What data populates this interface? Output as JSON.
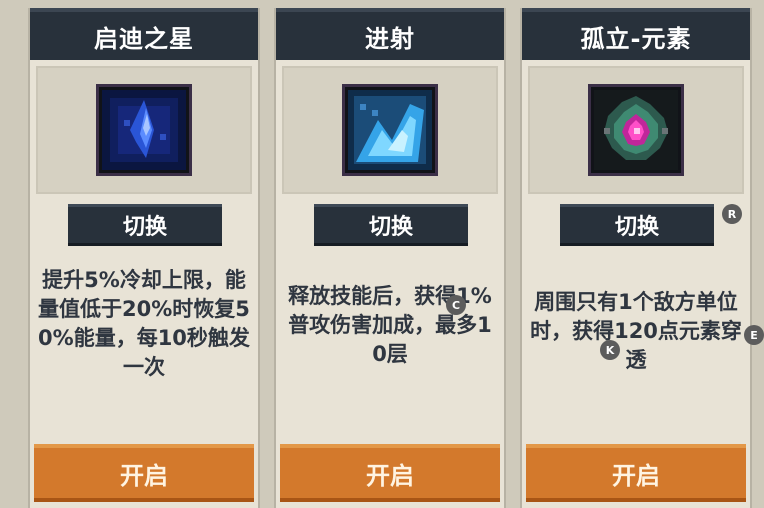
{
  "cards": [
    {
      "title": "启迪之星",
      "icon": "blue-star-crystal-icon",
      "switch_label": "切换",
      "description": "提升5%冷却上限，能量值低于20%时恢复50%能量，每10秒触发一次",
      "enable_label": "开启"
    },
    {
      "title": "进射",
      "icon": "cyan-burst-icon",
      "switch_label": "切换",
      "description": "释放技能后，获得1%普攻伤害加成，最多10层",
      "enable_label": "开启"
    },
    {
      "title": "孤立-元素",
      "icon": "pink-element-orb-icon",
      "switch_label": "切换",
      "description": "周围只有1个敌方单位时，获得120点元素穿透",
      "enable_label": "开启"
    }
  ],
  "hints": {
    "r": "R",
    "c": "C",
    "k": "K",
    "e": "E"
  },
  "colors": {
    "header": "#28313b",
    "enable_button": "#d3792c",
    "card_bg": "#e8e3d6"
  }
}
